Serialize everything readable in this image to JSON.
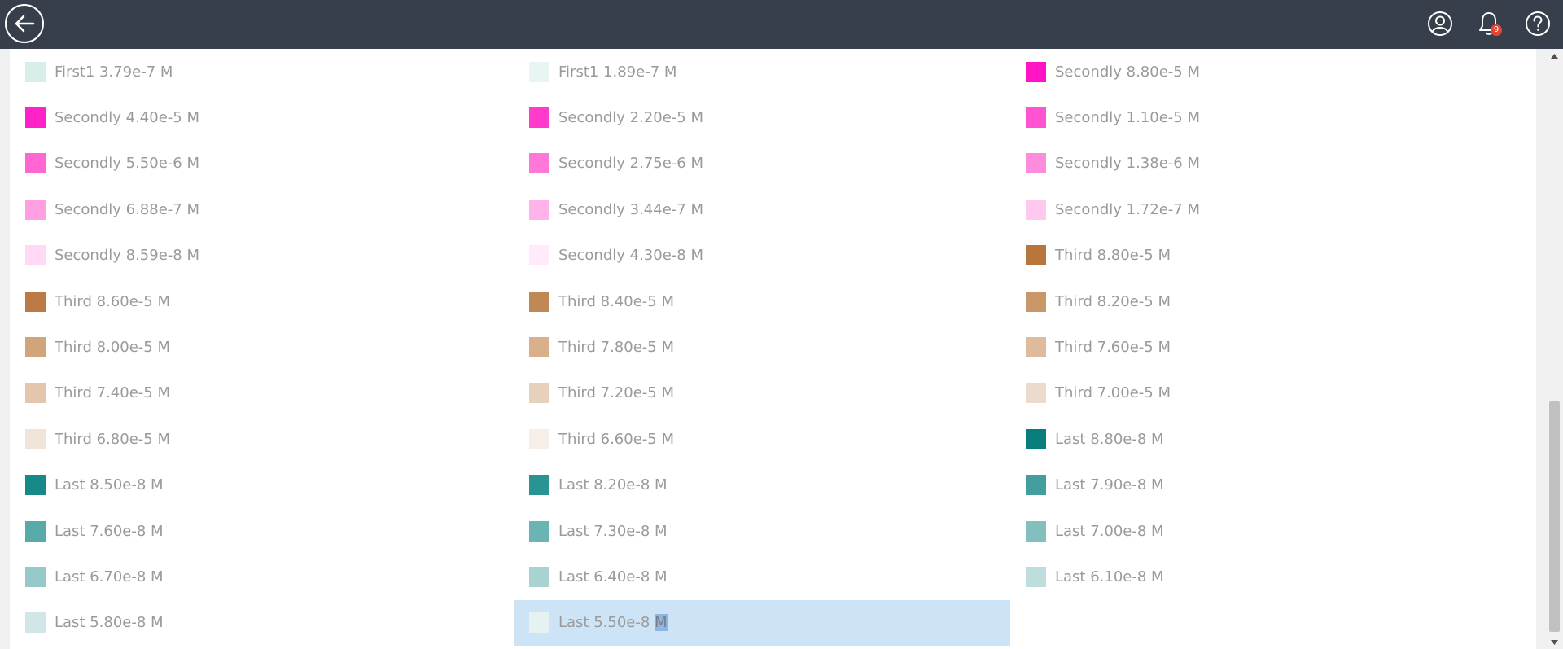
{
  "header": {
    "icons": [
      "back-arrow-icon",
      "user-profile-icon",
      "bell-icon",
      "help-icon"
    ],
    "notification_count": "9"
  },
  "legend": {
    "items": [
      {
        "label": "First1 3.79e-7 M",
        "color": "#d7eee9"
      },
      {
        "label": "First1 1.89e-7 M",
        "color": "#e8f5f2"
      },
      {
        "label": "Secondly 8.80e-5 M",
        "color": "#ff13c5"
      },
      {
        "label": "Secondly 4.40e-5 M",
        "color": "#ff22c8"
      },
      {
        "label": "Secondly 2.20e-5 M",
        "color": "#ff3bcd"
      },
      {
        "label": "Secondly 1.10e-5 M",
        "color": "#ff54d2"
      },
      {
        "label": "Secondly 5.50e-6 M",
        "color": "#ff66d4"
      },
      {
        "label": "Secondly 2.75e-6 M",
        "color": "#ff77d7"
      },
      {
        "label": "Secondly 1.38e-6 M",
        "color": "#ff8bdd"
      },
      {
        "label": "Secondly 6.88e-7 M",
        "color": "#ff9fe2"
      },
      {
        "label": "Secondly 3.44e-7 M",
        "color": "#ffb3e8"
      },
      {
        "label": "Secondly 1.72e-7 M",
        "color": "#ffc8ef"
      },
      {
        "label": "Secondly 8.59e-8 M",
        "color": "#ffd9f5"
      },
      {
        "label": "Secondly 4.30e-8 M",
        "color": "#ffebf9"
      },
      {
        "label": "Third 8.80e-5 M",
        "color": "#b8753c"
      },
      {
        "label": "Third 8.60e-5 M",
        "color": "#bb7a43"
      },
      {
        "label": "Third 8.40e-5 M",
        "color": "#c08854"
      },
      {
        "label": "Third 8.20e-5 M",
        "color": "#c99667"
      },
      {
        "label": "Third 8.00e-5 M",
        "color": "#d1a47b"
      },
      {
        "label": "Third 7.80e-5 M",
        "color": "#d8b08b"
      },
      {
        "label": "Third 7.60e-5 M",
        "color": "#ddbb9b"
      },
      {
        "label": "Third 7.40e-5 M",
        "color": "#e3c6ab"
      },
      {
        "label": "Third 7.20e-5 M",
        "color": "#e8d1bc"
      },
      {
        "label": "Third 7.00e-5 M",
        "color": "#ecdbcc"
      },
      {
        "label": "Third 6.80e-5 M",
        "color": "#f1e5da"
      },
      {
        "label": "Third 6.60e-5 M",
        "color": "#f6eee7"
      },
      {
        "label": "Last 8.80e-8 M",
        "color": "#087d7b"
      },
      {
        "label": "Last 8.50e-8 M",
        "color": "#178988"
      },
      {
        "label": "Last 8.20e-8 M",
        "color": "#2a9394"
      },
      {
        "label": "Last 7.90e-8 M",
        "color": "#449e9f"
      },
      {
        "label": "Last 7.60e-8 M",
        "color": "#58a9a9"
      },
      {
        "label": "Last 7.30e-8 M",
        "color": "#6cb3b3"
      },
      {
        "label": "Last 7.00e-8 M",
        "color": "#82bfbf"
      },
      {
        "label": "Last 6.70e-8 M",
        "color": "#96c9c9"
      },
      {
        "label": "Last 6.40e-8 M",
        "color": "#a9d3d3"
      },
      {
        "label": "Last 6.10e-8 M",
        "color": "#bedede"
      },
      {
        "label": "Last 5.80e-8 M",
        "color": "#d1e7e7"
      },
      {
        "label": "Last 5.50e-8",
        "label_highlight": "M",
        "color": "#e6f1f2",
        "selected": true
      }
    ]
  }
}
